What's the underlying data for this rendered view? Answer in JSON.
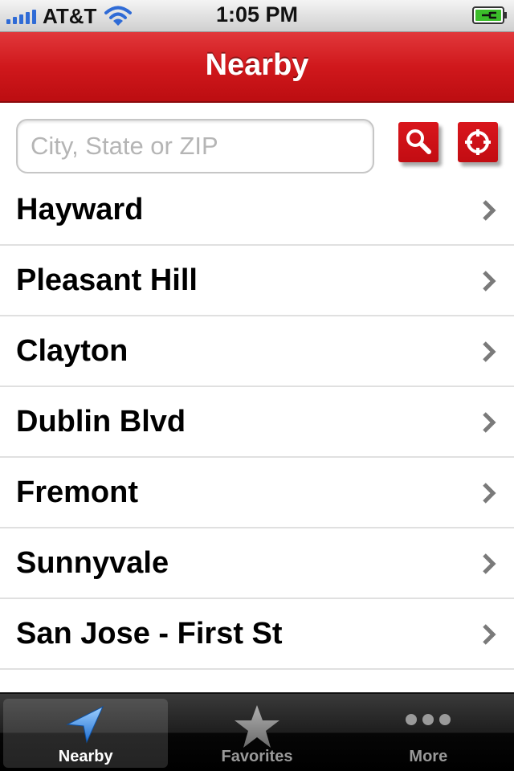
{
  "status_bar": {
    "carrier": "AT&T",
    "time": "1:05 PM",
    "signal_icon": "signal-bars-icon",
    "wifi_icon": "wifi-icon",
    "battery_icon": "battery-charging-icon"
  },
  "nav": {
    "title": "Nearby"
  },
  "search": {
    "placeholder": "City, State or ZIP",
    "value": "",
    "search_icon": "magnifier-icon",
    "locate_icon": "crosshair-icon"
  },
  "locations": [
    {
      "label": "Hayward"
    },
    {
      "label": "Pleasant Hill"
    },
    {
      "label": "Clayton"
    },
    {
      "label": "Dublin Blvd"
    },
    {
      "label": "Fremont"
    },
    {
      "label": "Sunnyvale"
    },
    {
      "label": "San Jose - First St"
    },
    {
      "label": ""
    }
  ],
  "tabs": [
    {
      "label": "Nearby",
      "icon": "location-arrow-icon",
      "active": true
    },
    {
      "label": "Favorites",
      "icon": "star-icon",
      "active": false
    },
    {
      "label": "More",
      "icon": "more-dots-icon",
      "active": false
    }
  ],
  "colors": {
    "brand_red": "#cc0000",
    "tab_active_blue": "#3a8de0"
  }
}
